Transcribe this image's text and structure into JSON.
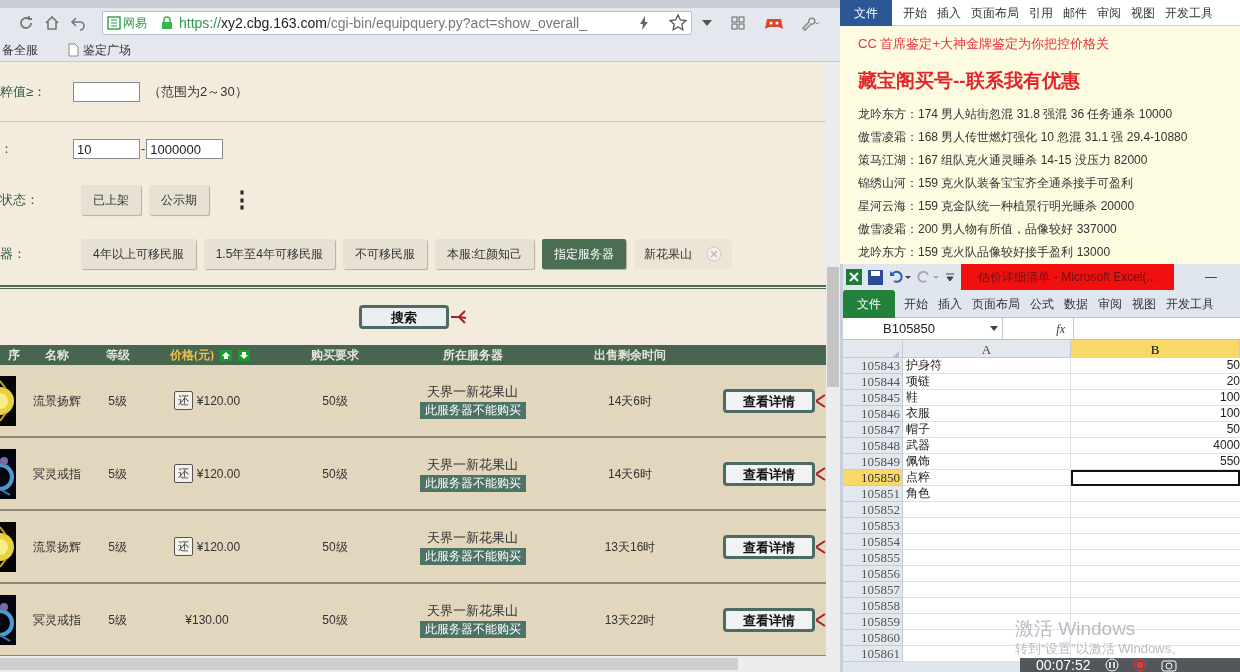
{
  "browser": {
    "site_badge": "网易",
    "url_scheme": "https://",
    "url_host": "xy2.cbg.163.com",
    "url_path": "/cgi-bin/equipquery.py?act=show_overall_",
    "bookmarks": [
      "备全服",
      "鉴定广场"
    ]
  },
  "filters": {
    "purity": {
      "label": "粹值≥：",
      "hint": "（范围为2～30）"
    },
    "price": {
      "label": "：",
      "min": "10",
      "separator": "-",
      "max": "1000000"
    },
    "status": {
      "label": "状态：",
      "options": [
        {
          "label": "已上架",
          "selected": false
        },
        {
          "label": "公示期",
          "selected": false
        }
      ],
      "more": "⋮"
    },
    "server": {
      "label": "器：",
      "options": [
        {
          "label": "4年以上可移民服",
          "selected": false
        },
        {
          "label": "1.5年至4年可移民服",
          "selected": false
        },
        {
          "label": "不可移民服",
          "selected": false
        },
        {
          "label": "本服:红颜知己",
          "selected": false
        },
        {
          "label": "指定服务器",
          "selected": true
        }
      ],
      "chosen": "新花果山"
    }
  },
  "search_button": "搜索",
  "table": {
    "columns": [
      "序",
      "名称",
      "等级",
      "价格(元)",
      "购买要求",
      "所在服务器",
      "出售剩余时间"
    ],
    "rows": [
      {
        "name": "流景扬辉",
        "level": "5级",
        "bargain": "还",
        "price": "¥120.00",
        "requirement": "50级",
        "server": "天界一新花果山",
        "server_note": "此服务器不能购买",
        "remaining": "14天6时",
        "action": "查看详情"
      },
      {
        "name": "冥灵戒指",
        "level": "5级",
        "bargain": "还",
        "price": "¥120.00",
        "requirement": "50级",
        "server": "天界一新花果山",
        "server_note": "此服务器不能购买",
        "remaining": "14天6时",
        "action": "查看详情"
      },
      {
        "name": "流景扬辉",
        "level": "5级",
        "bargain": "还",
        "price": "¥120.00",
        "requirement": "50级",
        "server": "天界一新花果山",
        "server_note": "此服务器不能购买",
        "remaining": "13天16时",
        "action": "查看详情"
      },
      {
        "name": "冥灵戒指",
        "level": "5级",
        "price": "¥130.00",
        "requirement": "50级",
        "server": "天界一新花果山",
        "server_note": "此服务器不能购买",
        "remaining": "13天22时",
        "action": "查看详情"
      }
    ]
  },
  "word": {
    "tabs": [
      {
        "label": "文件",
        "selected": true
      },
      {
        "label": "开始",
        "selected": false
      },
      {
        "label": "插入",
        "selected": false
      },
      {
        "label": "页面布局",
        "selected": false
      },
      {
        "label": "引用",
        "selected": false
      },
      {
        "label": "邮件",
        "selected": false
      },
      {
        "label": "审阅",
        "selected": false
      },
      {
        "label": "视图",
        "selected": false
      },
      {
        "label": "开发工具",
        "selected": false
      }
    ],
    "lines": [
      {
        "kind": "note",
        "text": "CC 首席鉴定+大神金牌鉴定为你把控价格关"
      },
      {
        "kind": "headline",
        "text": "藏宝阁买号--联系我有优惠"
      },
      {
        "kind": "body",
        "text": "龙吟东方：174 男人站街忽混 31.8 强混 36 任务通杀 10000"
      },
      {
        "kind": "body",
        "text": "傲雪凌霜：168 男人传世燃灯强化 10 忽混 31.1 强 29.4-10880"
      },
      {
        "kind": "body",
        "text": "策马江湖：167 组队克火通灵睡杀 14-15 没压力 82000"
      },
      {
        "kind": "body",
        "text": "锦绣山河：159 克火队装备宝宝齐全通杀接手可盈利"
      },
      {
        "kind": "body",
        "text": "星河云海：159 克金队统一种植景行明光睡杀 20000"
      },
      {
        "kind": "body",
        "text": "傲雪凌霜：200 男人物有所值，品像较好 337000"
      },
      {
        "kind": "body",
        "text": "龙吟东方：159 克火队品像较好接手盈利 13000"
      }
    ]
  },
  "excel": {
    "title": "估价详细清单 - Microsoft Excel(...",
    "minimize": "—",
    "tabs": [
      {
        "label": "文件",
        "selected": true
      },
      {
        "label": "开始",
        "selected": false
      },
      {
        "label": "插入",
        "selected": false
      },
      {
        "label": "页面布局",
        "selected": false
      },
      {
        "label": "公式",
        "selected": false
      },
      {
        "label": "数据",
        "selected": false
      },
      {
        "label": "审阅",
        "selected": false
      },
      {
        "label": "视图",
        "selected": false
      },
      {
        "label": "开发工具",
        "selected": false
      }
    ],
    "name_box": "B105850",
    "fx": "fx",
    "columns": [
      {
        "label": "A",
        "selected": false
      },
      {
        "label": "B",
        "selected": true
      }
    ],
    "rows": [
      {
        "number": "105843",
        "a": "护身符",
        "b": "50",
        "selected": false
      },
      {
        "number": "105844",
        "a": "项链",
        "b": "20",
        "selected": false
      },
      {
        "number": "105845",
        "a": "鞋",
        "b": "100",
        "selected": false
      },
      {
        "number": "105846",
        "a": "衣服",
        "b": "100",
        "selected": false
      },
      {
        "number": "105847",
        "a": "帽子",
        "b": "50",
        "selected": false
      },
      {
        "number": "105848",
        "a": "武器",
        "b": "4000",
        "selected": false
      },
      {
        "number": "105849",
        "a": "佩饰",
        "b": "550",
        "selected": false
      },
      {
        "number": "105850",
        "a": "点粹",
        "selected": true
      },
      {
        "number": "105851",
        "a": "角色",
        "selected": false
      },
      {
        "number": "105852",
        "selected": false
      },
      {
        "number": "105853",
        "selected": false
      },
      {
        "number": "105854",
        "selected": false
      },
      {
        "number": "105855",
        "selected": false
      },
      {
        "number": "105856",
        "selected": false
      },
      {
        "number": "105857",
        "selected": false
      },
      {
        "number": "105858",
        "selected": false
      },
      {
        "number": "105859",
        "selected": false
      },
      {
        "number": "105860",
        "selected": false
      },
      {
        "number": "105861",
        "selected": false
      }
    ]
  },
  "activation": {
    "title": "激活 Windows",
    "hint": "转到“设置”以激活 Windows。"
  },
  "recorder": {
    "time": "00:07:52"
  }
}
